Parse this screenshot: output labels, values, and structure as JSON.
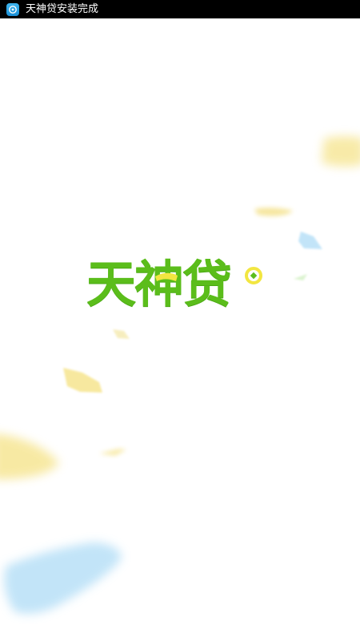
{
  "status_bar": {
    "notification_icon": "app-notification-icon",
    "notification_text": "天神贷安装完成"
  },
  "splash": {
    "logo_text": "天神贷",
    "colors": {
      "logo_green": "#5bbd1b",
      "logo_accent_yellow": "#f2e641",
      "confetti_yellow": "#f7e79a",
      "confetti_blue": "#bfe3f8",
      "confetti_green": "#d7f2c9"
    }
  }
}
